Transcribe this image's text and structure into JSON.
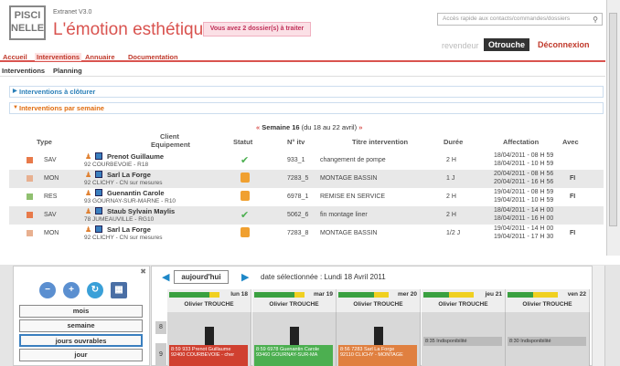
{
  "header": {
    "logo_line1": "PISCI",
    "logo_line2": "NELLE",
    "version": "Extranet V3.0",
    "tagline": "L'émotion esthétique",
    "alert": "Vous avez 2 dossier(s) à traiter",
    "search_placeholder": "Accès rapide aux contacts/commandes/dossiers",
    "user_role": "revendeur",
    "user_name": "Otrouche",
    "logout": "Déconnexion"
  },
  "mainnav": [
    "Accueil",
    "Interventions",
    "Annuaire",
    "Documentation"
  ],
  "subnav": [
    "Interventions",
    "Planning"
  ],
  "panels": {
    "cloturer": "Interventions à clôturer",
    "semaine": "Interventions par semaine"
  },
  "weeknav": {
    "prev": "«",
    "label": "Semaine 16",
    "range": "(du 18 au 22 avril)",
    "next": "»"
  },
  "table": {
    "headers": {
      "type": "Type",
      "client": "Client",
      "equipement": "Equipement",
      "statut": "Statut",
      "itv": "N° itv",
      "titre": "Titre intervention",
      "duree": "Durée",
      "affectation": "Affectation",
      "avec": "Avec"
    },
    "rows": [
      {
        "type": "SAV",
        "color": "#e87a4a",
        "client": "Prenot Guillaume",
        "city": "92 COURBEVOIE - R18",
        "status": "check",
        "itv": "933_1",
        "titre": "changement de pompe",
        "duree": "2 H",
        "aff1": "18/04/2011 - 08 H 59",
        "aff2": "18/04/2011 - 10 H 59",
        "avec": ""
      },
      {
        "type": "MON",
        "color": "#e8b090",
        "client": "Sarl La Forge",
        "city": "92 CLICHY - CN sur mesures",
        "status": "lock",
        "itv": "7283_5",
        "titre": "MONTAGE BASSIN",
        "duree": "1 J",
        "aff1": "20/04/2011 - 08 H 56",
        "aff2": "20/04/2011 - 16 H 56",
        "avec": "FI"
      },
      {
        "type": "RES",
        "color": "#90c070",
        "client": "Guenantin Carole",
        "city": "93 GOURNAY-SUR-MARNE - R10",
        "status": "lock",
        "itv": "6978_1",
        "titre": "REMISE EN SERVICE",
        "duree": "2 H",
        "aff1": "19/04/2011 - 08 H 59",
        "aff2": "19/04/2011 - 10 H 59",
        "avec": "FI"
      },
      {
        "type": "SAV",
        "color": "#e87a4a",
        "client": "Staub Sylvain Maylis",
        "city": "78 JUMEAUVILLE - RG10",
        "status": "check",
        "itv": "5062_6",
        "titre": "fin montage liner",
        "duree": "2 H",
        "aff1": "18/04/2011 - 14 H 00",
        "aff2": "18/04/2011 - 16 H 00",
        "avec": ""
      },
      {
        "type": "MON",
        "color": "#e8b090",
        "client": "Sarl La Forge",
        "city": "92 CLICHY - CN sur mesures",
        "status": "lock",
        "itv": "7283_8",
        "titre": "MONTAGE BASSIN",
        "duree": "1/2 J",
        "aff1": "19/04/2011 - 14 H 00",
        "aff2": "19/04/2011 - 17 H 30",
        "avec": "FI"
      }
    ]
  },
  "planning": {
    "views": [
      "mois",
      "semaine",
      "jours ouvrables",
      "jour"
    ],
    "today": "aujourd'hui",
    "selected": "date sélectionnée : Lundi 18 Avril 2011",
    "days": [
      {
        "name": "lun 18",
        "tech": "Olivier TROUCHE",
        "load": 0.8
      },
      {
        "name": "mar 19",
        "tech": "Olivier TROUCHE",
        "load": 0.8
      },
      {
        "name": "mer 20",
        "tech": "Olivier TROUCHE",
        "load": 0.7
      },
      {
        "name": "jeu 21",
        "tech": "Olivier TROUCHE",
        "load": 0.5
      },
      {
        "name": "ven 22",
        "tech": "Olivier TROUCHE",
        "load": 0.5
      }
    ],
    "hours": [
      "8",
      "9"
    ],
    "slots": [
      {
        "text": "8:59 933 Prenot Guillaume",
        "sub": "92400 COURBEVOIE - cher"
      },
      {
        "text": "8:59 6978 Guenantin Carole",
        "sub": "93460 GOURNAY-SUR-MA"
      },
      {
        "text": "8:56 7283 Sarl La Forge",
        "sub": "92110 CLICHY - MONTAGE"
      },
      {
        "text": "8:35 Indisponibilité",
        "sub": ""
      },
      {
        "text": "8:30 Indisponibilité",
        "sub": ""
      }
    ]
  }
}
